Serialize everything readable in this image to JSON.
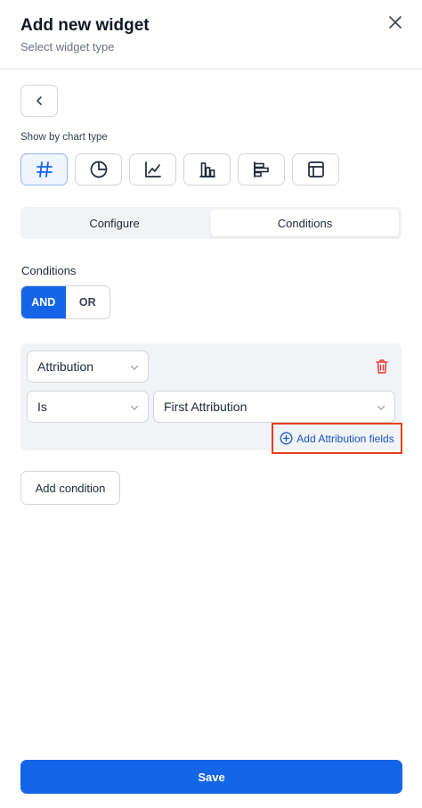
{
  "header": {
    "title": "Add new widget",
    "subtitle": "Select widget type"
  },
  "chart_section": {
    "label": "Show by chart type",
    "types": [
      {
        "icon": "hash-icon",
        "active": true
      },
      {
        "icon": "pie-chart-icon",
        "active": false
      },
      {
        "icon": "line-chart-icon",
        "active": false
      },
      {
        "icon": "bar-chart-icon",
        "active": false
      },
      {
        "icon": "horizontal-bar-chart-icon",
        "active": false
      },
      {
        "icon": "table-icon",
        "active": false
      }
    ]
  },
  "tabs": [
    {
      "label": "Configure",
      "active": false
    },
    {
      "label": "Conditions",
      "active": true
    }
  ],
  "conditions": {
    "label": "Conditions",
    "logic": {
      "and_label": "AND",
      "or_label": "OR",
      "selected": "AND"
    },
    "rows": [
      {
        "field": "Attribution",
        "operator": "Is",
        "value": "First Attribution"
      }
    ],
    "add_fields_label": "Add Attribution fields",
    "add_condition_label": "Add condition"
  },
  "footer": {
    "save_label": "Save"
  },
  "colors": {
    "accent": "#1565e8",
    "highlight_border": "#e2401c",
    "delete": "#e53935"
  }
}
